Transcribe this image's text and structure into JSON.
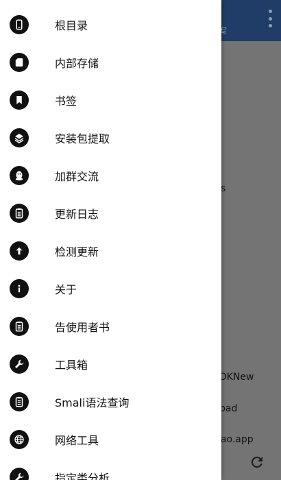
{
  "header": {
    "subtitle": "写"
  },
  "background": {
    "text_s": "s",
    "text_dknew": "DKNew",
    "text_bad": "bad",
    "text_app": "iao.app"
  },
  "drawer": {
    "items": [
      {
        "label": "根目录",
        "icon": "phone-icon"
      },
      {
        "label": "内部存储",
        "icon": "sd-card-icon"
      },
      {
        "label": "书签",
        "icon": "bookmark-icon"
      },
      {
        "label": "安装包提取",
        "icon": "layers-icon"
      },
      {
        "label": "加群交流",
        "icon": "qq-penguin-icon"
      },
      {
        "label": "更新日志",
        "icon": "clipboard-icon"
      },
      {
        "label": "检测更新",
        "icon": "arrow-up-icon"
      },
      {
        "label": "关于",
        "icon": "info-icon"
      },
      {
        "label": "告使用者书",
        "icon": "clipboard-icon"
      },
      {
        "label": "工具箱",
        "icon": "wrench-icon"
      },
      {
        "label": "Smali语法查询",
        "icon": "clipboard-icon"
      },
      {
        "label": "网络工具",
        "icon": "globe-icon"
      },
      {
        "label": "指定类分析",
        "icon": "wrench-icon"
      }
    ]
  }
}
